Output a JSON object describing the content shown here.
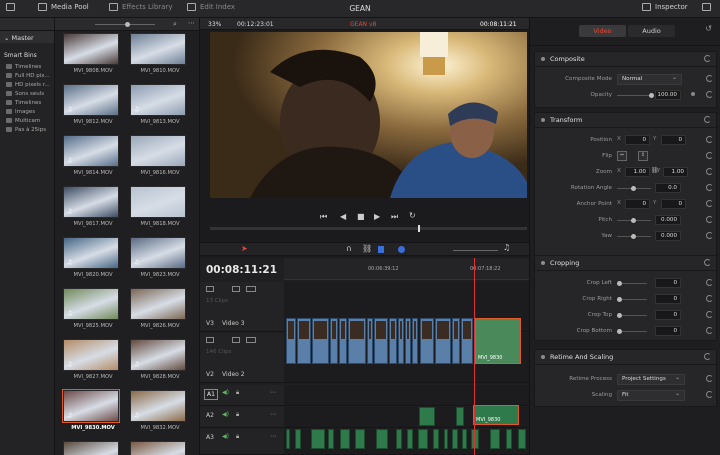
{
  "topbar": {
    "media_pool": "Media Pool",
    "effects_library": "Effects Library",
    "edit_index": "Edit Index",
    "project_title": "GEAN",
    "inspector": "Inspector"
  },
  "sidebar": {
    "master": "Master",
    "smart_bins": "Smart Bins",
    "items": [
      "Timelines",
      "Full HD pix...",
      "HD pixels r...",
      "Sons seuls",
      "Timelines",
      "Images",
      "Multicam",
      "Pas à 25ips"
    ]
  },
  "media_pool": {
    "clips": [
      {
        "name": "MVI_9808.MOV",
        "audio": false,
        "bold": false
      },
      {
        "name": "MVI_9810.MOV",
        "audio": false,
        "bold": false
      },
      {
        "name": "MVI_9812.MOV",
        "audio": true,
        "bold": false
      },
      {
        "name": "MVI_9813.MOV",
        "audio": true,
        "bold": false
      },
      {
        "name": "MVI_9814.MOV",
        "audio": true,
        "bold": false
      },
      {
        "name": "MVI_9816.MOV",
        "audio": false,
        "bold": false
      },
      {
        "name": "MVI_9817.MOV",
        "audio": true,
        "bold": false
      },
      {
        "name": "MVI_9818.MOV",
        "audio": false,
        "bold": false
      },
      {
        "name": "MVI_9820.MOV",
        "audio": true,
        "bold": false
      },
      {
        "name": "MVI_9823.MOV",
        "audio": true,
        "bold": false
      },
      {
        "name": "MVI_9825.MOV",
        "audio": true,
        "bold": false
      },
      {
        "name": "MVI_9826.MOV",
        "audio": false,
        "bold": false
      },
      {
        "name": "MVI_9827.MOV",
        "audio": true,
        "bold": false
      },
      {
        "name": "MVI_9828.MOV",
        "audio": true,
        "bold": false
      },
      {
        "name": "MVI_9830.MOV",
        "audio": true,
        "bold": true,
        "selected": true
      },
      {
        "name": "MVI_9832.MOV",
        "audio": true,
        "bold": false
      },
      {
        "name": "",
        "audio": false,
        "bold": false
      },
      {
        "name": "",
        "audio": false,
        "bold": false
      }
    ],
    "thumb_colors": [
      "#4a3a38",
      "#6d7f95",
      "#5b6f87",
      "#8c9cb0",
      "#566d8a",
      "#9aa8b9",
      "#3c4b62",
      "#b7c3d0",
      "#456584",
      "#596a83",
      "#6f8a5a",
      "#7a6654",
      "#b38c66",
      "#62493c",
      "#6b4a48",
      "#8a6a48",
      "#5a4b3f",
      "#7a5840"
    ]
  },
  "viewer": {
    "zoom": "33%",
    "timecode_left": "00:12:23:01",
    "clip_name": "GEAN v8",
    "timecode_right": "00:08:11:21"
  },
  "timeline": {
    "timecode": "00:08:11:21",
    "ruler_labels": [
      "00:06:39:12",
      "00:07:18:22"
    ],
    "tracks": {
      "v3": {
        "id": "V3",
        "name": "Video 3",
        "clips_text": "13 Clips"
      },
      "v2": {
        "id": "V2",
        "name": "Video 2",
        "clips_text": "146 Clips"
      },
      "a1": {
        "id": "A1"
      },
      "a2": {
        "id": "A2"
      },
      "a3": {
        "id": "A3"
      }
    },
    "clip_label": "MVI_9830"
  },
  "inspector": {
    "tab_video": "Video",
    "tab_audio": "Audio",
    "composite": {
      "title": "Composite",
      "mode_label": "Composite Mode",
      "mode_value": "Normal",
      "opacity_label": "Opacity",
      "opacity_value": "100.00"
    },
    "transform": {
      "title": "Transform",
      "position_label": "Position",
      "position_x": "0",
      "position_y": "0",
      "flip_label": "Flip",
      "zoom_label": "Zoom",
      "zoom_x": "1.00",
      "zoom_y": "1.00",
      "rotation_label": "Rotation Angle",
      "rotation_value": "0.0",
      "anchor_label": "Anchor Point",
      "anchor_x": "0",
      "anchor_y": "0",
      "pitch_label": "Pitch",
      "pitch_value": "0.000",
      "yaw_label": "Yaw",
      "yaw_value": "0.000",
      "x": "X",
      "y": "Y"
    },
    "cropping": {
      "title": "Cropping",
      "left_label": "Crop Left",
      "left_value": "0",
      "right_label": "Crop Right",
      "right_value": "0",
      "top_label": "Crop Top",
      "top_value": "0",
      "bottom_label": "Crop Bottom",
      "bottom_value": "0"
    },
    "retime": {
      "title": "Retime And Scaling",
      "process_label": "Retime Process",
      "process_value": "Project Settings",
      "scaling_label": "Scaling",
      "scaling_value": "Fit"
    }
  },
  "colors": {
    "accent_red": "#e53935",
    "video_clip": "#5a7fa8",
    "audio_clip": "#2f7a4a",
    "selected_clip": "#e05a25"
  }
}
